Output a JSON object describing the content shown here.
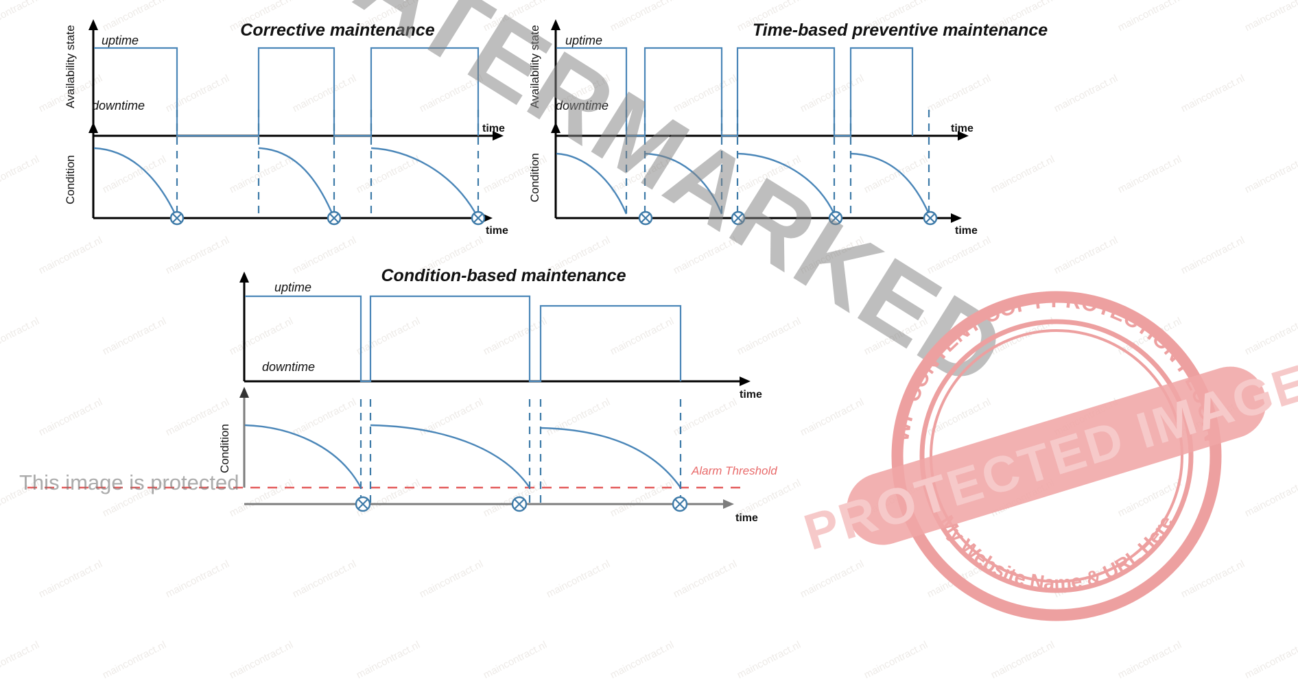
{
  "figure": {
    "caption_absent": true,
    "line_color": "#4a86b8",
    "alarm_color": "#e35b5b",
    "axis_color": "#000000"
  },
  "charts": [
    {
      "id": "corrective",
      "title": "Corrective maintenance",
      "top": {
        "y_axis_label": "Availability state",
        "upper_state_label": "uptime",
        "lower_state_label": "downtime",
        "x_axis_label": "time"
      },
      "bottom": {
        "y_axis_label": "Condition",
        "x_axis_label": "time"
      }
    },
    {
      "id": "time-based-preventive",
      "title": "Time-based preventive maintenance",
      "top": {
        "y_axis_label": "Availability state",
        "upper_state_label": "uptime",
        "lower_state_label": "downtime",
        "x_axis_label": "time"
      },
      "bottom": {
        "y_axis_label": "Condition",
        "x_axis_label": "time"
      }
    },
    {
      "id": "condition-based",
      "title": "Condition-based maintenance",
      "top": {
        "y_axis_label": "",
        "upper_state_label": "uptime",
        "lower_state_label": "downtime",
        "x_axis_label": "time"
      },
      "bottom": {
        "y_axis_label": "Condition",
        "x_axis_label": "time",
        "threshold_label": "Alarm Threshold"
      }
    }
  ],
  "chart_data": {
    "type": "line",
    "title": "Maintenance strategies: availability state and condition over time",
    "xlabel": "time",
    "panels": [
      {
        "name": "Corrective maintenance",
        "availability": {
          "ylabel": "Availability state",
          "ytick_labels": [
            "uptime",
            "downtime"
          ],
          "ylim": [
            0,
            1
          ],
          "series": [
            {
              "name": "availability",
              "type": "step",
              "points": [
                [
                  0,
                  1
                ],
                [
                  0.27,
                  1
                ],
                [
                  0.27,
                  0
                ],
                [
                  0.46,
                  0
                ],
                [
                  0.46,
                  1
                ],
                [
                  0.67,
                  1
                ],
                [
                  0.67,
                  0
                ],
                [
                  0.8,
                  0
                ],
                [
                  0.8,
                  1
                ],
                [
                  1.0,
                  1
                ]
              ]
            }
          ]
        },
        "condition": {
          "ylabel": "Condition",
          "ylim": [
            0,
            1
          ],
          "degradation_cycles": [
            {
              "start_x": 0.0,
              "end_x": 0.27,
              "start_condition": 1.0,
              "end_condition": 0.0
            },
            {
              "start_x": 0.46,
              "end_x": 0.67,
              "start_condition": 1.0,
              "end_condition": 0.0
            },
            {
              "start_x": 0.8,
              "end_x": 1.0,
              "start_condition": 1.0,
              "end_condition": 0.0
            }
          ],
          "failure_markers_x": [
            0.27,
            0.67,
            1.0
          ],
          "marker_symbol": "circle-x"
        }
      },
      {
        "name": "Time-based preventive maintenance",
        "availability": {
          "ylabel": "Availability state",
          "ytick_labels": [
            "uptime",
            "downtime"
          ],
          "ylim": [
            0,
            1
          ],
          "series": [
            {
              "name": "availability",
              "type": "step",
              "points": [
                [
                  0,
                  1
                ],
                [
                  0.21,
                  1
                ],
                [
                  0.21,
                  0
                ],
                [
                  0.255,
                  0
                ],
                [
                  0.255,
                  1
                ],
                [
                  0.455,
                  1
                ],
                [
                  0.455,
                  0
                ],
                [
                  0.5,
                  0
                ],
                [
                  0.5,
                  1
                ],
                [
                  0.7,
                  1
                ],
                [
                  0.7,
                  0
                ],
                [
                  0.745,
                  0
                ],
                [
                  0.745,
                  1
                ],
                [
                  0.945,
                  1
                ],
                [
                  0.945,
                  0
                ],
                [
                  1.0,
                  0
                ]
              ]
            }
          ]
        },
        "condition": {
          "ylabel": "Condition",
          "ylim": [
            0,
            1
          ],
          "degradation_cycles": [
            {
              "start_x": 0.0,
              "end_x": 0.21,
              "start_condition": 1.0,
              "end_condition": 0.18
            },
            {
              "start_x": 0.255,
              "end_x": 0.455,
              "start_condition": 1.0,
              "end_condition": 0.18
            },
            {
              "start_x": 0.5,
              "end_x": 0.7,
              "start_condition": 1.0,
              "end_condition": 0.18
            },
            {
              "start_x": 0.745,
              "end_x": 0.945,
              "start_condition": 1.0,
              "end_condition": 0.18
            }
          ],
          "maintenance_markers_x": [
            0.21,
            0.455,
            0.7,
            0.945
          ],
          "marker_symbol": "circle-x"
        }
      },
      {
        "name": "Condition-based maintenance",
        "availability": {
          "ytick_labels": [
            "uptime",
            "downtime"
          ],
          "ylim": [
            0,
            1
          ],
          "series": [
            {
              "name": "availability",
              "type": "step",
              "points": [
                [
                  0,
                  1
                ],
                [
                  0.245,
                  1
                ],
                [
                  0.245,
                  0
                ],
                [
                  0.275,
                  0
                ],
                [
                  0.275,
                  1
                ],
                [
                  0.595,
                  1
                ],
                [
                  0.595,
                  0
                ],
                [
                  0.625,
                  0
                ],
                [
                  0.625,
                  1
                ],
                [
                  1.0,
                  1
                ]
              ]
            }
          ]
        },
        "condition": {
          "ylabel": "Condition",
          "ylim": [
            0,
            1
          ],
          "threshold": {
            "label": "Alarm Threshold",
            "value": 0.12,
            "color": "#e35b5b",
            "style": "dashed"
          },
          "degradation_cycles": [
            {
              "start_x": 0.0,
              "end_x": 0.245,
              "start_condition": 1.0,
              "end_condition": 0.12
            },
            {
              "start_x": 0.275,
              "end_x": 0.595,
              "start_condition": 1.0,
              "end_condition": 0.12
            },
            {
              "start_x": 0.625,
              "end_x": 0.94,
              "start_condition": 1.0,
              "end_condition": 0.12
            }
          ],
          "alarm_markers_x": [
            0.245,
            0.595,
            0.94
          ],
          "marker_symbol": "circle-x"
        }
      }
    ]
  },
  "overlays": {
    "diagonal_watermark": "WATERMARKED",
    "tiled_watermark": "maincontract.nl",
    "protected_notice": "This image is protected",
    "stamp": {
      "outer_text_top": "WP CONTENT COPY PROTECTION PLUGIN",
      "outer_text_bottom": "My Website Name & URL Here",
      "band_text": "PROTECTED IMAGE",
      "color": "#eda0a0"
    }
  }
}
